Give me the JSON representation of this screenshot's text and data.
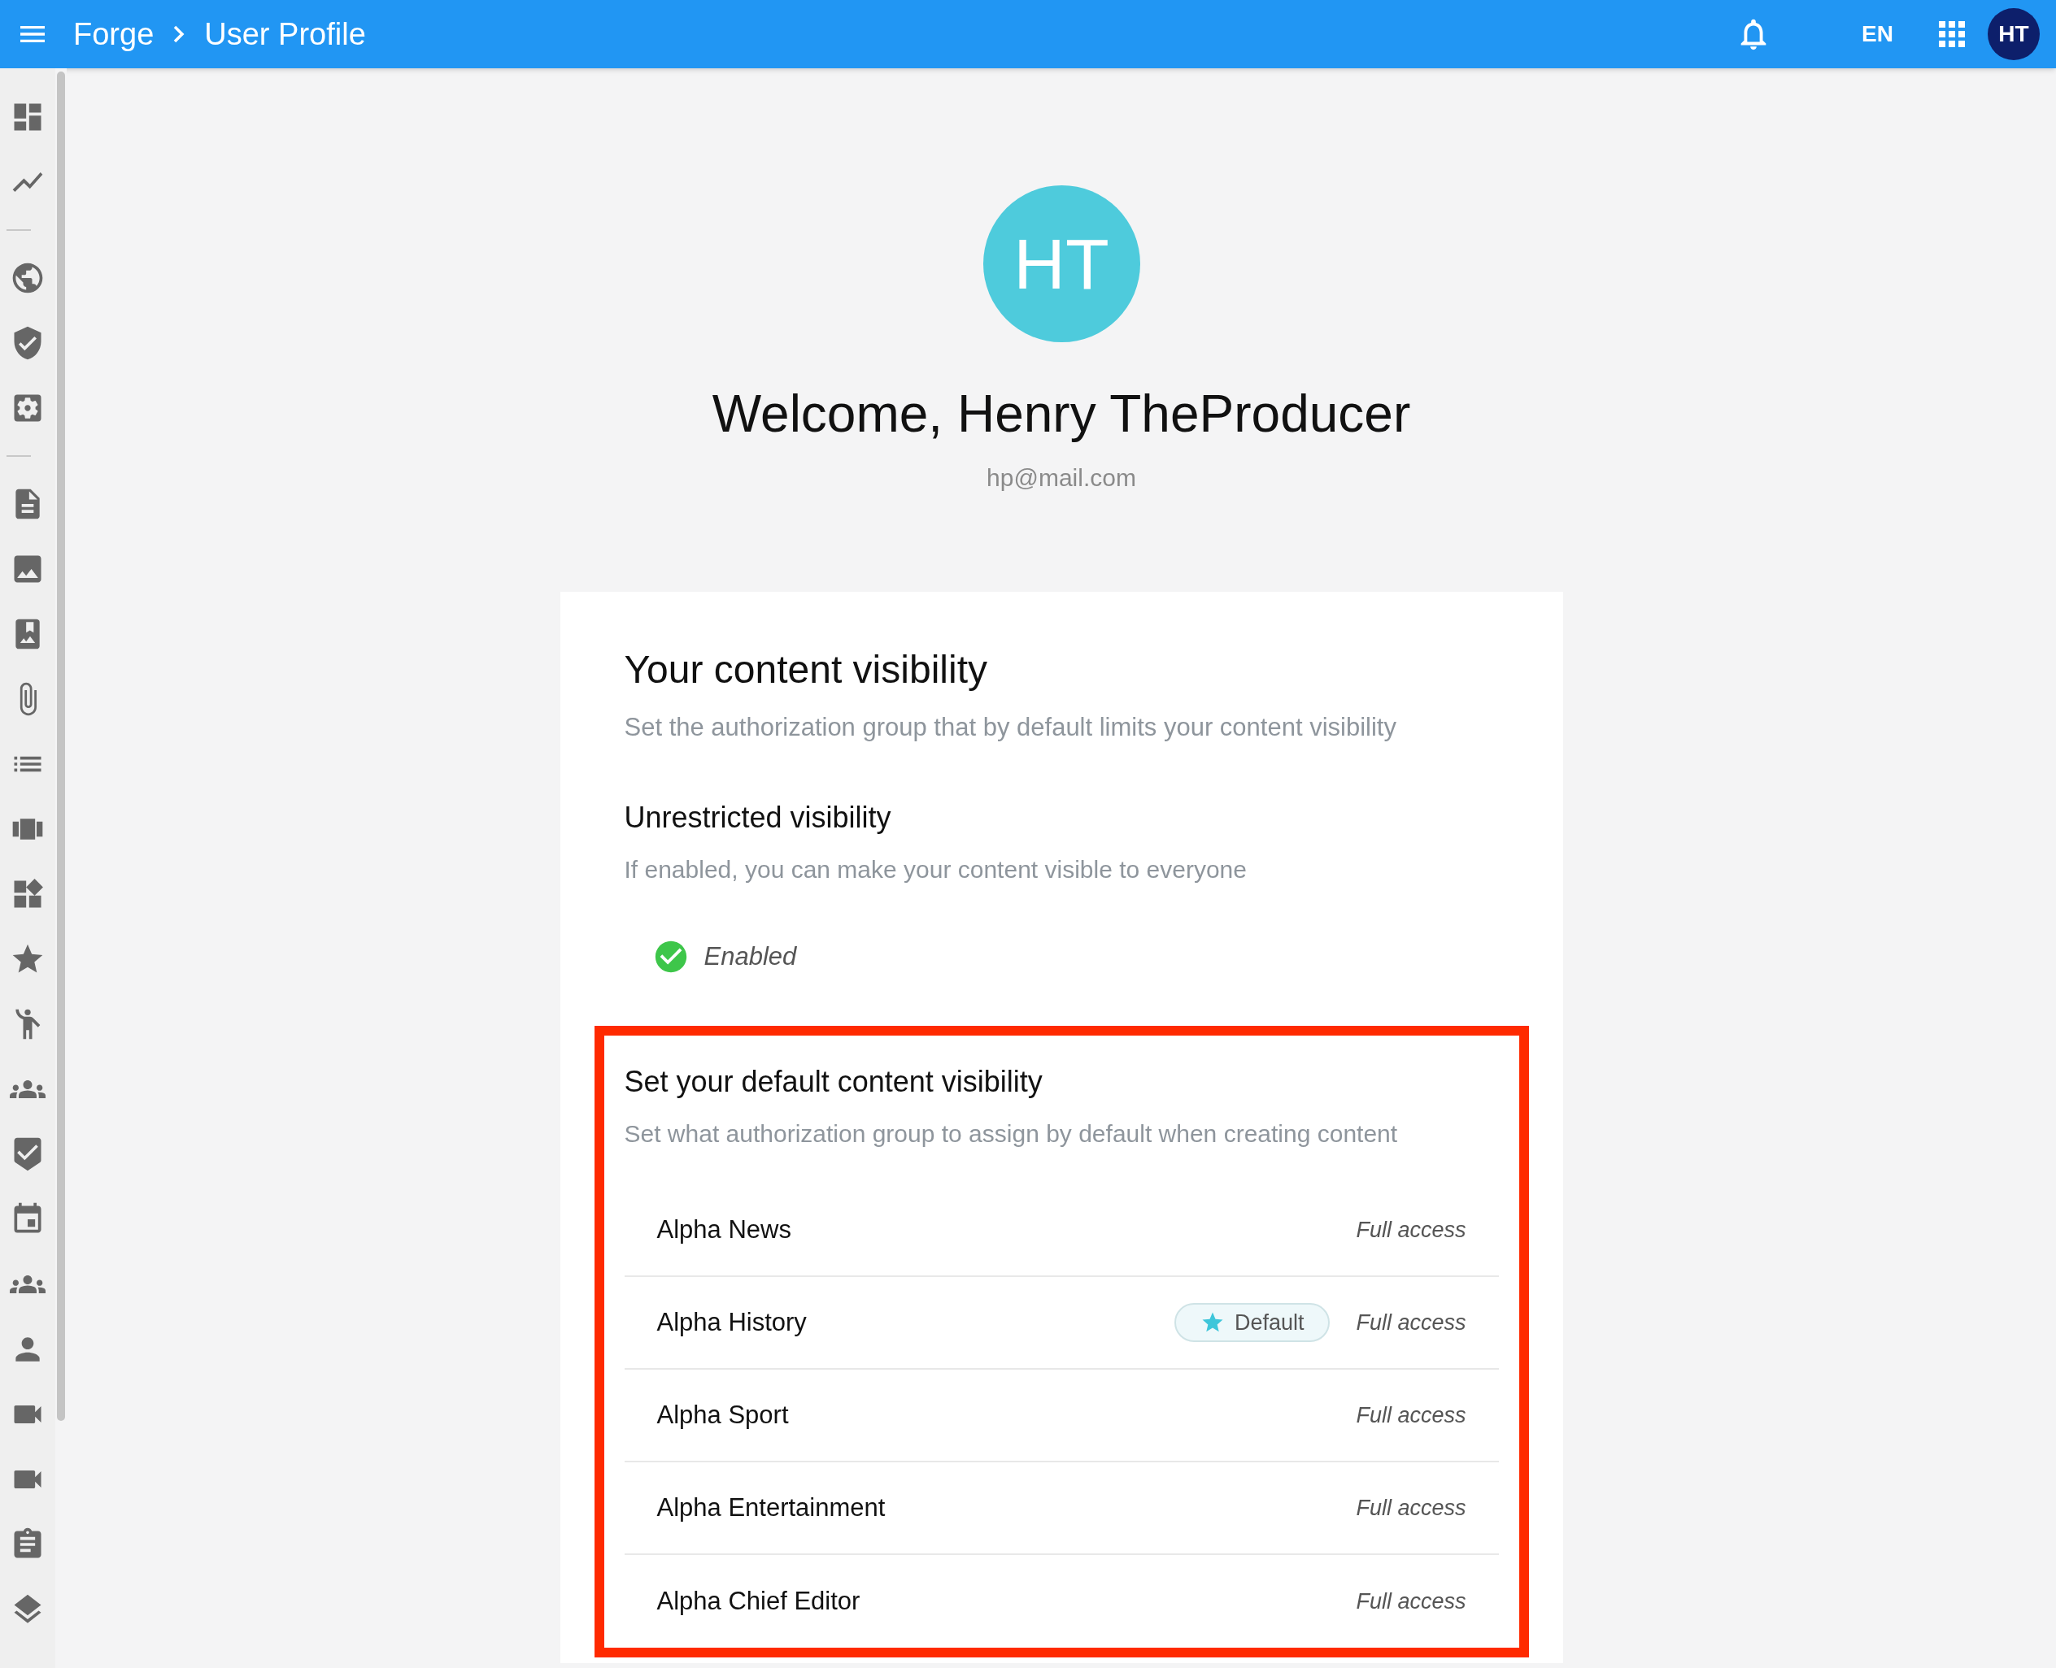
{
  "top_bar": {
    "breadcrumb": [
      "Forge",
      "User Profile"
    ],
    "language": "EN",
    "avatar_initials": "HT"
  },
  "profile": {
    "avatar_initials": "HT",
    "welcome": "Welcome, Henry TheProducer",
    "email": "hp@mail.com"
  },
  "visibility_card": {
    "title": "Your content visibility",
    "subtitle": "Set the authorization group that by default limits your content visibility",
    "unrestricted": {
      "title": "Unrestricted visibility",
      "description": "If enabled, you can make your content visible to everyone",
      "status": "Enabled",
      "enabled": true
    },
    "default_section": {
      "highlighted": true,
      "title": "Set your default content visibility",
      "subtitle": "Set what authorization group to assign by default when creating content",
      "default_label": "Default",
      "groups": [
        {
          "name": "Alpha News",
          "access": "Full access",
          "default": false
        },
        {
          "name": "Alpha History",
          "access": "Full access",
          "default": true
        },
        {
          "name": "Alpha Sport",
          "access": "Full access",
          "default": false
        },
        {
          "name": "Alpha Entertainment",
          "access": "Full access",
          "default": false
        },
        {
          "name": "Alpha Chief Editor",
          "access": "Full access",
          "default": false
        }
      ]
    }
  }
}
